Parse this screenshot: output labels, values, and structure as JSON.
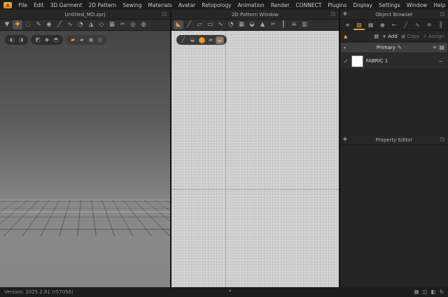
{
  "colors": {
    "accent": "#e9a43c"
  },
  "menu": {
    "items": [
      "File",
      "Edit",
      "3D Garment",
      "2D Pattern",
      "Sewing",
      "Materials",
      "Avatar",
      "Retopology",
      "Animation",
      "Render",
      "CONNECT",
      "Plugins",
      "Display",
      "Settings",
      "Window",
      "Help"
    ]
  },
  "window_controls": [
    {
      "name": "minimize-button",
      "glyph": "–"
    },
    {
      "name": "restore-button",
      "glyph": "◱"
    },
    {
      "name": "close-button",
      "glyph": "×"
    }
  ],
  "viewport3d": {
    "title": "Untitled_MD.zprj",
    "float_glyph": "◳",
    "toolbar": [
      {
        "name": "simulate-tool",
        "glyph": "▼"
      },
      {
        "name": "select-move-tool",
        "glyph": "✚",
        "active": true
      },
      {
        "name": "select-mesh-tool",
        "glyph": "◌"
      },
      {
        "name": "fix-pin-tool",
        "glyph": "✎"
      },
      {
        "name": "pin-tool",
        "glyph": "◉"
      },
      {
        "name": "tack-tool",
        "glyph": "╱"
      },
      {
        "name": "sewing-tool",
        "glyph": "∿"
      },
      {
        "name": "fold-arrangement-tool",
        "glyph": "◔"
      },
      {
        "name": "avatar-tool",
        "glyph": "◮"
      },
      {
        "name": "gizmo-tool",
        "glyph": "◇"
      },
      {
        "name": "grid-arrange-tool",
        "glyph": "▦"
      },
      {
        "name": "scissors-tool",
        "glyph": "✂"
      },
      {
        "name": "steam-tool",
        "glyph": "◎"
      },
      {
        "name": "render-style-tool",
        "glyph": "◍"
      }
    ],
    "overlay": {
      "g1": [
        {
          "name": "shaded-view-icon",
          "glyph": "◐"
        },
        {
          "name": "textured-view-icon",
          "glyph": "◑"
        }
      ],
      "g2": [
        {
          "name": "show-garment-icon",
          "glyph": "◩"
        },
        {
          "name": "show-pins-icon",
          "glyph": "◆"
        },
        {
          "name": "show-avatar-icon",
          "glyph": "◓"
        }
      ],
      "g3": [
        {
          "name": "fabric-texture-toggle-icon",
          "glyph": "▰",
          "cls": "gold"
        },
        {
          "name": "fabric-plain-toggle-icon",
          "glyph": "▰"
        },
        {
          "name": "avatar-skin-toggle-icon",
          "glyph": "◉"
        },
        {
          "name": "monochrome-toggle-icon",
          "glyph": "◎"
        }
      ]
    }
  },
  "pattern2d": {
    "title": "2D Pattern Window",
    "float_glyph": "◳",
    "toolbar": [
      {
        "name": "transform-pattern-tool",
        "glyph": "◣",
        "active": true
      },
      {
        "name": "edit-pattern-tool",
        "glyph": "╱"
      },
      {
        "name": "polygon-tool",
        "glyph": "▱"
      },
      {
        "name": "rectangle-tool",
        "glyph": "▭"
      },
      {
        "name": "curve-point-tool",
        "glyph": "∿"
      },
      {
        "name": "trace-tool",
        "glyph": "◔"
      },
      {
        "name": "grading-tool",
        "glyph": "▦"
      },
      {
        "name": "flatten-tool",
        "glyph": "◒"
      },
      {
        "name": "unfold-tool",
        "glyph": "▲"
      },
      {
        "name": "cut-sew-tool",
        "glyph": "✂"
      },
      {
        "name": "seamline-tool",
        "glyph": "║"
      },
      {
        "name": "stitch-tool",
        "glyph": "≡"
      },
      {
        "name": "measure-tool",
        "glyph": "▥"
      }
    ],
    "overlay": [
      {
        "name": "edit-texture-icon",
        "glyph": "╱"
      },
      {
        "name": "show-garment-2d-icon",
        "glyph": "◒"
      },
      {
        "name": "pattern-info-icon",
        "glyph": "i",
        "cls": "badge"
      },
      {
        "name": "show-fabric-icon",
        "glyph": "▰"
      },
      {
        "name": "textured-pattern-icon",
        "glyph": "◒",
        "cls": "on"
      }
    ]
  },
  "object_browser": {
    "title": "Object Browser",
    "left_glyph": "✚",
    "float_glyph": "◳",
    "tabs": [
      {
        "name": "scene-tab",
        "glyph": "≡"
      },
      {
        "name": "fabric-tab",
        "glyph": "▨",
        "active": true
      },
      {
        "name": "graphic-tab",
        "glyph": "▦"
      },
      {
        "name": "button-tab",
        "glyph": "◉"
      },
      {
        "name": "buttonhole-tab",
        "glyph": "←"
      },
      {
        "name": "topstitch-tab",
        "glyph": "╱"
      },
      {
        "name": "piping-tab",
        "glyph": "∿"
      },
      {
        "name": "puckering-tab",
        "glyph": "≋"
      },
      {
        "name": "zipper-tab",
        "glyph": "║"
      }
    ],
    "actions": {
      "warning_glyph": "▲",
      "folder_glyph": "▤",
      "add_label": "+ Add",
      "copy_glyph": "▣",
      "copy_label": "Copy",
      "assign_glyph": "✓",
      "assign_label": "Assign"
    },
    "section": {
      "collapse_glyph": "▾",
      "name": "Primary",
      "edit_glyph": "✎",
      "add_glyph": "+",
      "folder_glyph": "▤"
    },
    "fabric": {
      "check_glyph": "✓",
      "label": "FABRIC 1",
      "minus_glyph": "−"
    }
  },
  "property_editor": {
    "title": "Property Editor",
    "left_glyph": "✚",
    "float_glyph": "◳"
  },
  "statusbar": {
    "version": "Version: 2025.2.81 (r57056)",
    "collapse_glyph": "▴",
    "icons": [
      {
        "name": "layout-windows-icon",
        "glyph": "▦"
      },
      {
        "name": "layout-preset-a-icon",
        "glyph": "◫"
      },
      {
        "name": "layout-preset-b-icon",
        "glyph": "◧"
      },
      {
        "name": "reset-layout-icon",
        "glyph": "↻"
      }
    ]
  }
}
